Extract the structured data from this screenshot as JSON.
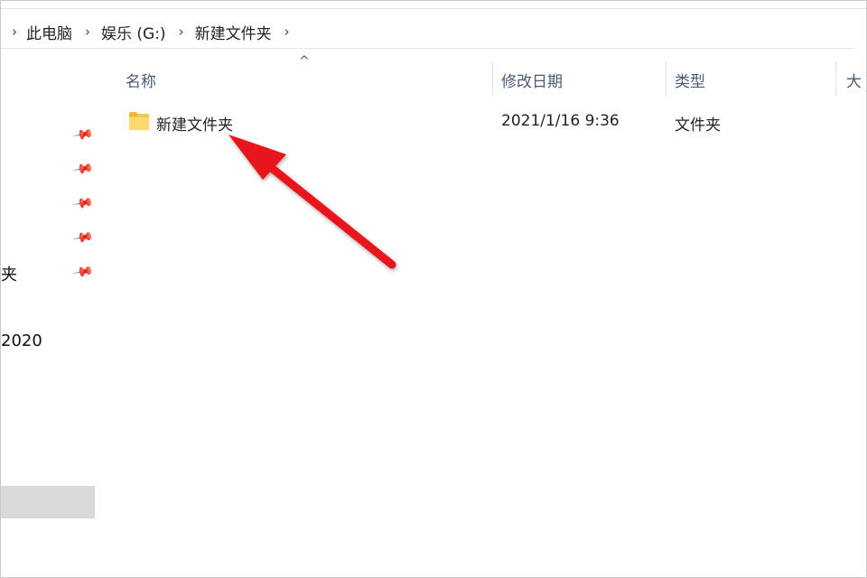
{
  "address_bar": {
    "crumbs": [
      "此电脑",
      "娱乐 (G:)",
      "新建文件夹"
    ],
    "separator": "›"
  },
  "nav_pane": {
    "partial_items": [
      "夹",
      "2020"
    ],
    "pin_icon": "pin-icon",
    "pin_count": 5
  },
  "file_list": {
    "columns": {
      "name": "名称",
      "modified": "修改日期",
      "type": "类型",
      "size": "大"
    },
    "sort_indicator": "^",
    "rows": [
      {
        "name": "新建文件夹",
        "modified": "2021/1/16 9:36",
        "type": "文件夹",
        "icon": "folder-icon"
      }
    ]
  },
  "annotation": {
    "arrow_color": "#e8141a"
  }
}
